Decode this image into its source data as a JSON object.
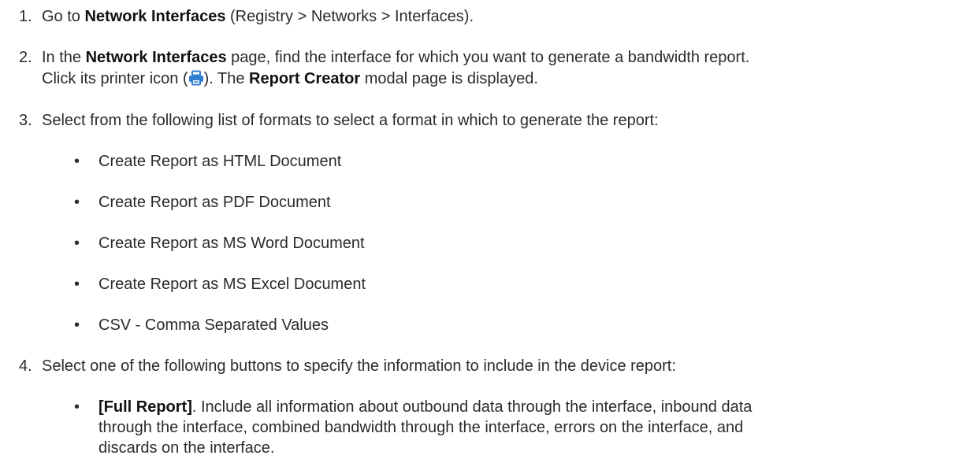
{
  "steps": [
    {
      "number": "1.",
      "segments": [
        {
          "t": "Go to ",
          "b": false
        },
        {
          "t": "Network Interfaces",
          "b": true
        },
        {
          "t": " (Registry > Networks > Interfaces).",
          "b": false
        }
      ]
    },
    {
      "number": "2.",
      "line1": [
        {
          "t": "In the ",
          "b": false
        },
        {
          "t": "Network Interfaces",
          "b": true
        },
        {
          "t": " page, find the interface for which you want to generate a bandwidth report.",
          "b": false
        }
      ],
      "line2_before_icon": "Click its printer icon (",
      "line2_after_icon": "). The ",
      "report_creator": "Report Creator",
      "line2_end": " modal page is displayed.",
      "icon": "printer-icon",
      "icon_color": "#2f7fd1"
    },
    {
      "number": "3.",
      "text": "Select from the following list of formats to select a format in which to generate the report:"
    },
    {
      "number": "4.",
      "text": "Select one of the following buttons to specify the information to include in the device report:"
    }
  ],
  "formats": [
    "Create Report as HTML Document",
    "Create Report as PDF Document",
    "Create Report as MS Word Document",
    "Create Report as MS Excel Document",
    "CSV - Comma Separated Values"
  ],
  "buttons_bullet": {
    "label": "[Full Report]",
    "line1": ". Include all information about outbound data through the interface, inbound data",
    "line2": "through the interface, combined bandwidth through the interface, errors on the interface, and",
    "line3": "discards on the interface."
  },
  "bullet_char": "•"
}
